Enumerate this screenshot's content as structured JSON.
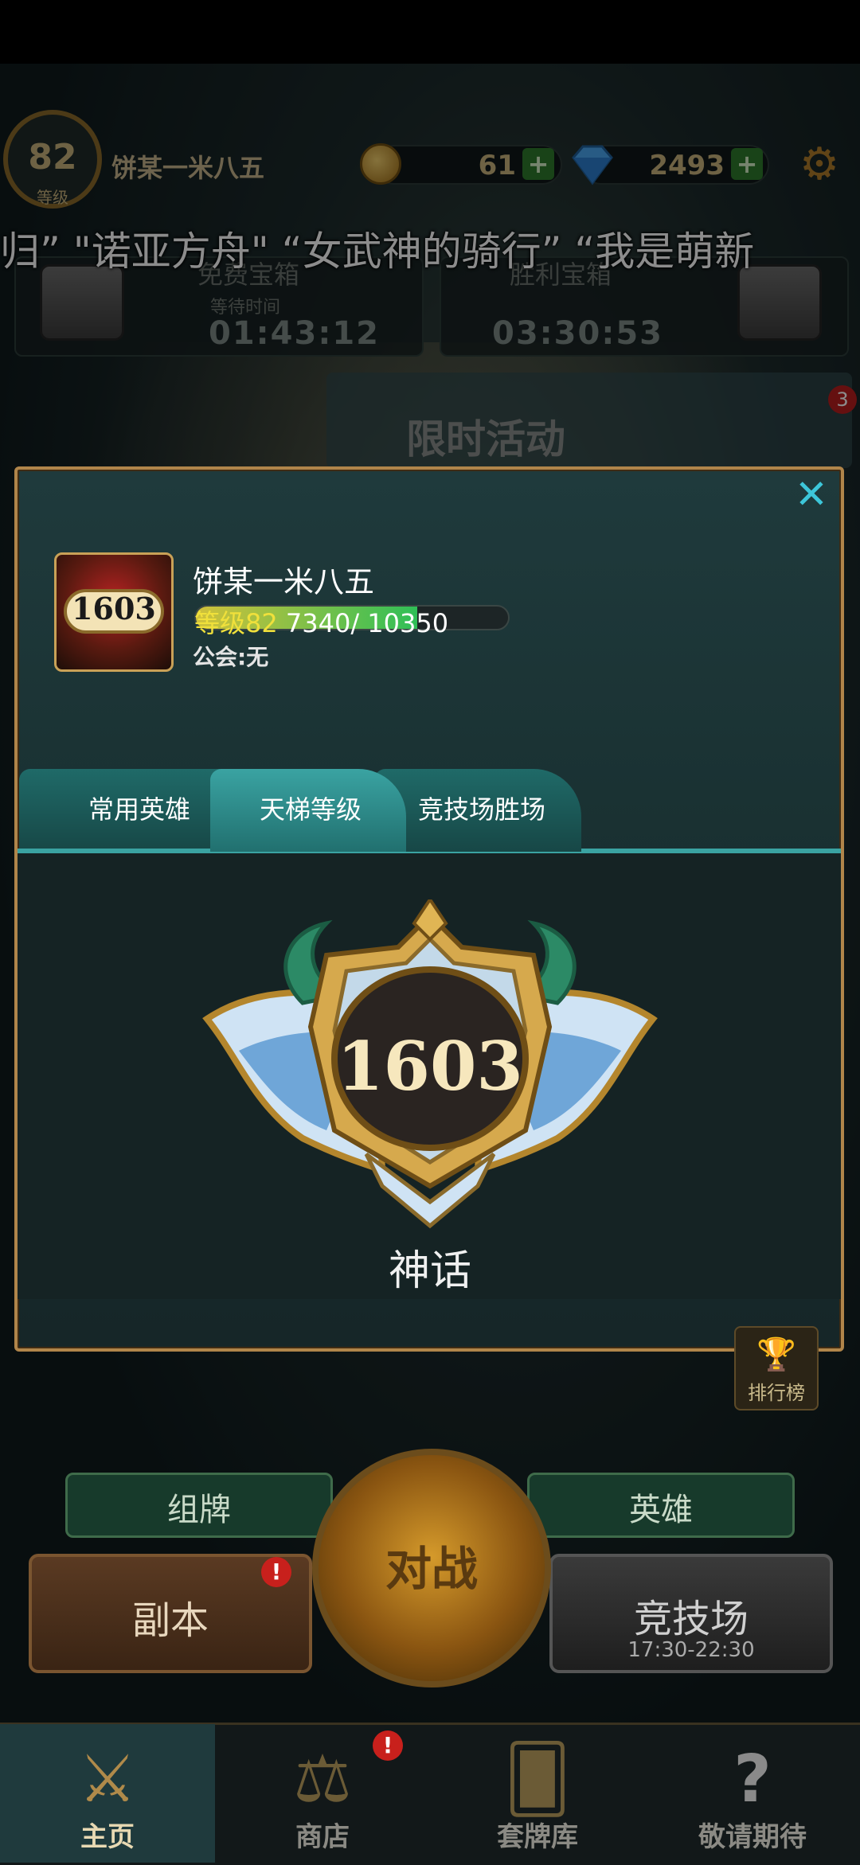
{
  "top_bar": {
    "level_number": "82",
    "level_label": "等级",
    "player_name": "饼某一米八五",
    "coins": "61",
    "gems": "2493",
    "plus_symbol": "+",
    "settings_icon": "gear-icon"
  },
  "marquee": {
    "text": "归”  \"诺亚方舟\"  “女武神的骑行”   “我是萌新"
  },
  "chests": [
    {
      "title": "免费宝箱",
      "wait_label": "等待时间",
      "time": "01:43:12"
    },
    {
      "title": "胜利宝箱",
      "time": "03:30:53"
    }
  ],
  "event": {
    "title": "限时活动",
    "badge": "3"
  },
  "profile_modal": {
    "close_symbol": "✕",
    "rank_badge_value": "1603",
    "player_name": "饼某一米八五",
    "level_text": "等级82",
    "xp_text": "7340/ 10350",
    "xp_current": 7340,
    "xp_max": 10350,
    "guild_text": "公会:无",
    "tabs": [
      {
        "label": "常用英雄",
        "active": false
      },
      {
        "label": "天梯等级",
        "active": true
      },
      {
        "label": "竞技场胜场",
        "active": false
      }
    ],
    "ladder_score": "1603",
    "rank_name": "神话"
  },
  "side": {
    "leaderboard_label": "排行榜"
  },
  "actions": {
    "deck_label": "组牌",
    "heroes_label": "英雄",
    "battle_label": "对战",
    "dungeon_label": "副本",
    "arena_label": "竞技场",
    "arena_time": "17:30-22:30",
    "alert_symbol": "!"
  },
  "nav": {
    "items": [
      {
        "label": "主页",
        "icon": "crossed-swords-icon",
        "active": true
      },
      {
        "label": "商店",
        "icon": "scales-icon",
        "active": false,
        "badge": "!"
      },
      {
        "label": "套牌库",
        "icon": "cards-icon",
        "active": false
      },
      {
        "label": "敬请期待",
        "icon": "question-icon",
        "active": false
      }
    ]
  },
  "colors": {
    "accent_teal": "#3aa3a2",
    "gold": "#b0854a",
    "xp_yellow": "#f0e03b"
  }
}
